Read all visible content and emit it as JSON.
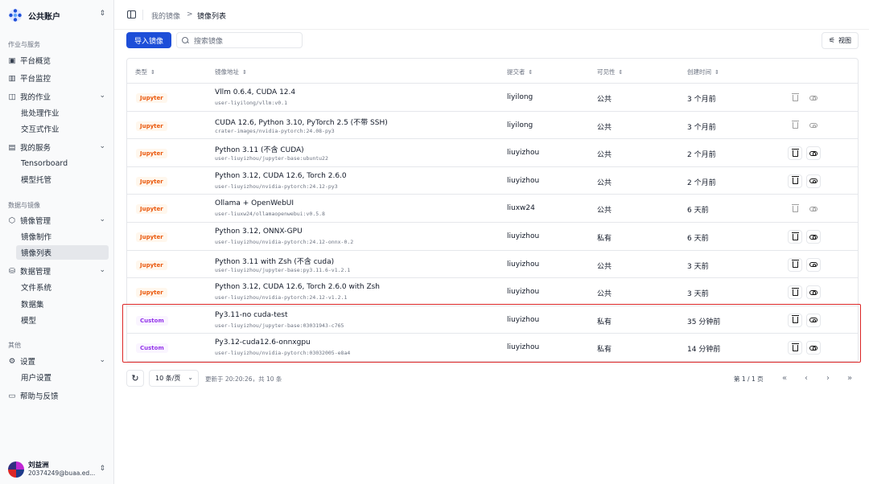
{
  "account": {
    "name": "公共账户"
  },
  "sections": {
    "work": "作业与服务",
    "data": "数据与镜像",
    "other": "其他"
  },
  "nav": {
    "overview": "平台概览",
    "monitor": "平台监控",
    "jobs": "我的作业",
    "batch": "批处理作业",
    "interactive": "交互式作业",
    "services": "我的服务",
    "tensorboard": "Tensorboard",
    "model_hosting": "模型托管",
    "image_mgmt": "镜像管理",
    "image_build": "镜像制作",
    "image_list": "镜像列表",
    "data_mgmt": "数据管理",
    "file_system": "文件系统",
    "dataset": "数据集",
    "model": "模型",
    "settings": "设置",
    "user_settings": "用户设置",
    "help": "帮助与反馈"
  },
  "user": {
    "name": "刘益洲",
    "email": "20374249@buaa.ed..."
  },
  "breadcrumb": {
    "parent": "我的镜像",
    "sep": ">",
    "current": "镜像列表"
  },
  "toolbar": {
    "import_label": "导入镜像",
    "search_placeholder": "搜索镜像",
    "view_label": "视图"
  },
  "table": {
    "headers": {
      "type": "类型",
      "address": "镜像地址",
      "submitter": "提交者",
      "visibility": "可见性",
      "created": "创建时间"
    },
    "rows": [
      {
        "type": "Jupyter",
        "name": "Vllm 0.6.4, CUDA 12.4",
        "addr": "user-liyilong/vllm:v0.1",
        "submitter": "liyilong",
        "visibility": "公共",
        "created": "3 个月前",
        "enabled": false
      },
      {
        "type": "Jupyter",
        "name": "CUDA 12.6, Python 3.10, PyTorch 2.5 (不带 SSH)",
        "addr": "crater-images/nvidia-pytorch:24.08-py3",
        "submitter": "liyilong",
        "visibility": "公共",
        "created": "3 个月前",
        "enabled": false
      },
      {
        "type": "Jupyter",
        "name": "Python 3.11 (不含 CUDA)",
        "addr": "user-liuyizhou/jupyter-base:ubuntu22",
        "submitter": "liuyizhou",
        "visibility": "公共",
        "created": "2 个月前",
        "enabled": true
      },
      {
        "type": "Jupyter",
        "name": "Python 3.12, CUDA 12.6, Torch 2.6.0",
        "addr": "user-liuyizhou/nvidia-pytorch:24.12-py3",
        "submitter": "liuyizhou",
        "visibility": "公共",
        "created": "2 个月前",
        "enabled": true
      },
      {
        "type": "Jupyter",
        "name": "Ollama + OpenWebUI",
        "addr": "user-liuxw24/ollamaopenwebui:v0.5.8",
        "submitter": "liuxw24",
        "visibility": "公共",
        "created": "6 天前",
        "enabled": false
      },
      {
        "type": "Jupyter",
        "name": "Python 3.12, ONNX-GPU",
        "addr": "user-liuyizhou/nvidia-pytorch:24.12-onnx-0.2",
        "submitter": "liuyizhou",
        "visibility": "私有",
        "created": "6 天前",
        "enabled": true
      },
      {
        "type": "Jupyter",
        "name": "Python 3.11 with Zsh (不含 cuda)",
        "addr": "user-liuyizhou/jupyter-base:py3.11.6-v1.2.1",
        "submitter": "liuyizhou",
        "visibility": "公共",
        "created": "3 天前",
        "enabled": true
      },
      {
        "type": "Jupyter",
        "name": "Python 3.12, CUDA 12.6, Torch 2.6.0 with Zsh",
        "addr": "user-liuyizhou/nvidia-pytorch:24.12-v1.2.1",
        "submitter": "liuyizhou",
        "visibility": "公共",
        "created": "3 天前",
        "enabled": true
      },
      {
        "type": "Custom",
        "name": "Py3.11-no cuda-test",
        "addr": "user-liuyizhou/jupyter-base:03031943-c765",
        "submitter": "liuyizhou",
        "visibility": "私有",
        "created": "35 分钟前",
        "enabled": true
      },
      {
        "type": "Custom",
        "name": "Py3.12-cuda12.6-onnxgpu",
        "addr": "user-liuyizhou/nvidia-pytorch:03032005-e8a4",
        "submitter": "liuyizhou",
        "visibility": "私有",
        "created": "14 分钟前",
        "enabled": true
      }
    ]
  },
  "footer": {
    "page_size": "10 条/页",
    "updated": "更新于 20:20:26，共 10 条",
    "page_info": "第 1 / 1 页"
  },
  "colors": {
    "primary": "#1d4ed8",
    "highlight": "#dc2626",
    "jupyter": "#ea580c",
    "custom": "#9333ea"
  }
}
